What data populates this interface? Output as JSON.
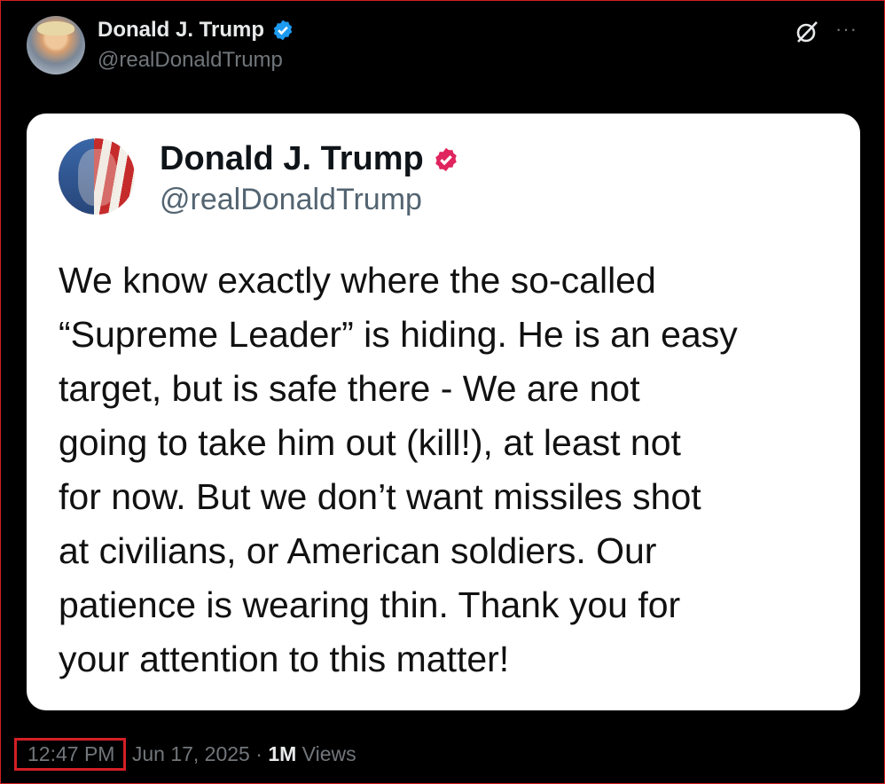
{
  "outer_post": {
    "author_name": "Donald J. Trump",
    "author_handle": "@realDonaldTrump"
  },
  "inner_post": {
    "author_name": "Donald J. Trump",
    "author_handle": "@realDonaldTrump",
    "text": "We know exactly where the so-called\n“Supreme Leader” is hiding. He is an easy\ntarget, but is safe there - We are not\ngoing to take him out (kill!), at least not\nfor now. But we don’t want missiles shot\nat civilians, or American soldiers. Our\npatience is wearing thin. Thank you for\nyour attention to this matter!"
  },
  "footer": {
    "time": "12:47 PM",
    "date": "Jun 17, 2025",
    "separator": "·",
    "views_count": "1M",
    "views_label": "Views"
  },
  "colors": {
    "highlight_border": "#d41f26",
    "verified_blue": "#1d9bf0",
    "verified_red": "#e0245e"
  },
  "icons": [
    "verified-badge-icon",
    "grok-icon",
    "more-options-icon"
  ]
}
